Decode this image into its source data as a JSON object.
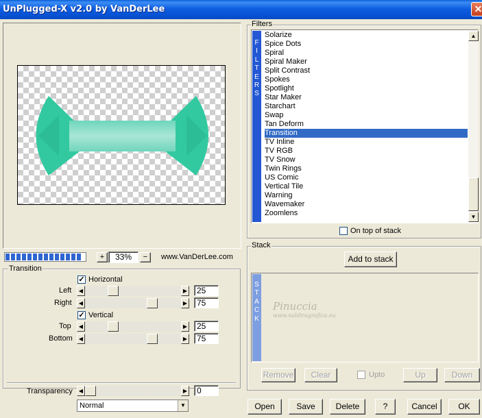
{
  "window": {
    "title": "UnPlugged-X v2.0 by VanDerLee",
    "close_label": "✕"
  },
  "preview": {
    "zoom": "33%",
    "zoom_in_label": "+",
    "zoom_out_label": "−",
    "website": "www.VanDerLee.com",
    "shape_color": "#32c9a0"
  },
  "transition": {
    "group_label": "Transition",
    "horizontal_label": "Horizontal",
    "horizontal_checked": true,
    "vertical_label": "Vertical",
    "vertical_checked": true,
    "left_label": "Left",
    "left_value": "25",
    "right_label": "Right",
    "right_value": "75",
    "top_label": "Top",
    "top_value": "25",
    "bottom_label": "Bottom",
    "bottom_value": "75"
  },
  "transparency": {
    "label": "Transparency",
    "value": "0"
  },
  "blend_mode": {
    "selected": "Normal"
  },
  "filters": {
    "group_label": "Filters",
    "vertical_label": [
      "F",
      "I",
      "L",
      "T",
      "E",
      "R",
      "S"
    ],
    "items": [
      "Solarize",
      "Spice Dots",
      "Spiral",
      "Spiral Maker",
      "Split Contrast",
      "Spokes",
      "Spotlight",
      "Star Maker",
      "Starchart",
      "Swap",
      "Tan Deform",
      "Transition",
      "TV Inline",
      "TV RGB",
      "TV Snow",
      "Twin Rings",
      "US Comic",
      "Vertical Tile",
      "Warning",
      "Wavemaker",
      "Zoomlens"
    ],
    "selected_index": 11,
    "on_top_label": "On top of stack"
  },
  "stack": {
    "group_label": "Stack",
    "add_label": "Add to stack",
    "vertical_label": [
      "S",
      "T",
      "A",
      "C",
      "K"
    ],
    "remove_label": "Remove",
    "clear_label": "Clear",
    "upto_label": "Upto",
    "up_label": "Up",
    "down_label": "Down"
  },
  "watermark": {
    "name": "Pinuccia",
    "site": "www.naldiragrafica.eu"
  },
  "buttons": {
    "open": "Open",
    "save": "Save",
    "delete": "Delete",
    "help": "?",
    "cancel": "Cancel",
    "ok": "OK"
  }
}
